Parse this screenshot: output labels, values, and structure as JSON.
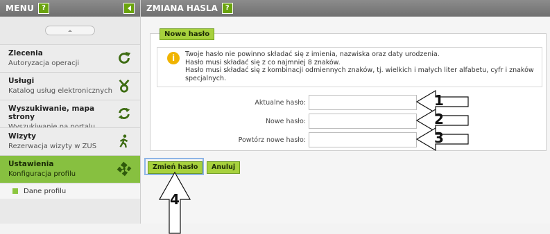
{
  "sidebar": {
    "title": "MENU",
    "help_badge": "?",
    "menu_items": [
      {
        "title": "Zlecenia",
        "subtitle": "Autoryzacja operacji",
        "icon": "refresh-icon"
      },
      {
        "title": "Usługi",
        "subtitle": "Katalog usług elektronicznych",
        "icon": "services-icon"
      },
      {
        "title": "Wyszukiwanie, mapa strony",
        "subtitle": "Wyszukiwanie na portalu",
        "icon": "refresh-icon"
      },
      {
        "title": "Wizyty",
        "subtitle": "Rezerwacja wizyty w ZUS",
        "icon": "walker-icon"
      },
      {
        "title": "Ustawienia",
        "subtitle": "Konfiguracja profilu",
        "icon": "puzzle-icon",
        "active": true
      }
    ],
    "submenu": {
      "label": "Dane profilu"
    }
  },
  "main": {
    "title": "ZMIANA HASLA",
    "help_badge": "?",
    "panel_tag": "Nowe hasło",
    "info": {
      "line1": "Twoje hasło nie powinno składać się z imienia, nazwiska oraz daty urodzenia.",
      "line2": "Hasło musi składać się z co najmniej 8 znaków.",
      "line3": "Hasło musi składać się z kombinacji odmiennych znaków, tj. wielkich i małych liter alfabetu, cyfr i znaków",
      "line4": "specjalnych."
    },
    "fields": [
      {
        "label": "Aktualne hasło:",
        "value": ""
      },
      {
        "label": "Nowe hasło:",
        "value": ""
      },
      {
        "label": "Powtórz nowe hasło:",
        "value": ""
      }
    ],
    "buttons": {
      "save": "Zmień hasło",
      "cancel": "Anuluj"
    }
  },
  "annotations": {
    "arrows": [
      "1",
      "2",
      "3",
      "4"
    ]
  },
  "colors": {
    "accent_green": "#a7d13d",
    "active_menu": "#87c040",
    "header_gray": "#7d7d7d",
    "info_icon": "#f0b400"
  }
}
